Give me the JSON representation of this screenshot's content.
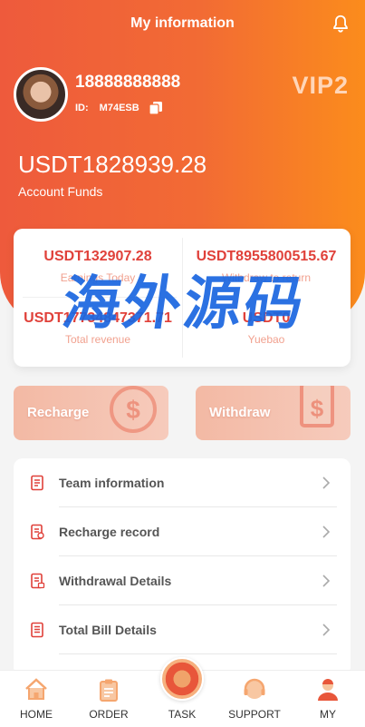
{
  "header": {
    "title": "My information",
    "bell_icon": "bell-icon"
  },
  "profile": {
    "phone": "18888888888",
    "id_label": "ID:",
    "id_value": "M74ESB",
    "vip": "VIP2"
  },
  "funds": {
    "amount": "USDT1828939.28",
    "label": "Account Funds"
  },
  "stats": [
    {
      "value": "USDT132907.28",
      "caption": "Earnings Today"
    },
    {
      "value": "USDT8955800515.67",
      "caption": "Withdraw to return"
    },
    {
      "value": "USDT17734847371.71",
      "caption": "Total revenue"
    },
    {
      "value": "USDT0",
      "caption": "Yuebao"
    }
  ],
  "watermark": "海外源码",
  "actions": {
    "recharge": "Recharge",
    "withdraw": "Withdraw"
  },
  "menu": [
    {
      "label": "Team information",
      "icon": "document-icon"
    },
    {
      "label": "Recharge record",
      "icon": "receipt-icon"
    },
    {
      "label": "Withdrawal Details",
      "icon": "receipt-lock-icon"
    },
    {
      "label": "Total Bill Details",
      "icon": "bill-icon"
    }
  ],
  "tabs": [
    {
      "label": "HOME",
      "icon": "home-icon"
    },
    {
      "label": "ORDER",
      "icon": "clipboard-icon"
    },
    {
      "label": "TASK",
      "icon": "task-icon"
    },
    {
      "label": "SUPPORT",
      "icon": "headset-icon"
    },
    {
      "label": "MY",
      "icon": "user-icon"
    }
  ],
  "colors": {
    "accent": "#f26b34",
    "value_red": "#e0413a",
    "caption_pink": "#f1a18f",
    "icon_red": "#e0413a"
  }
}
